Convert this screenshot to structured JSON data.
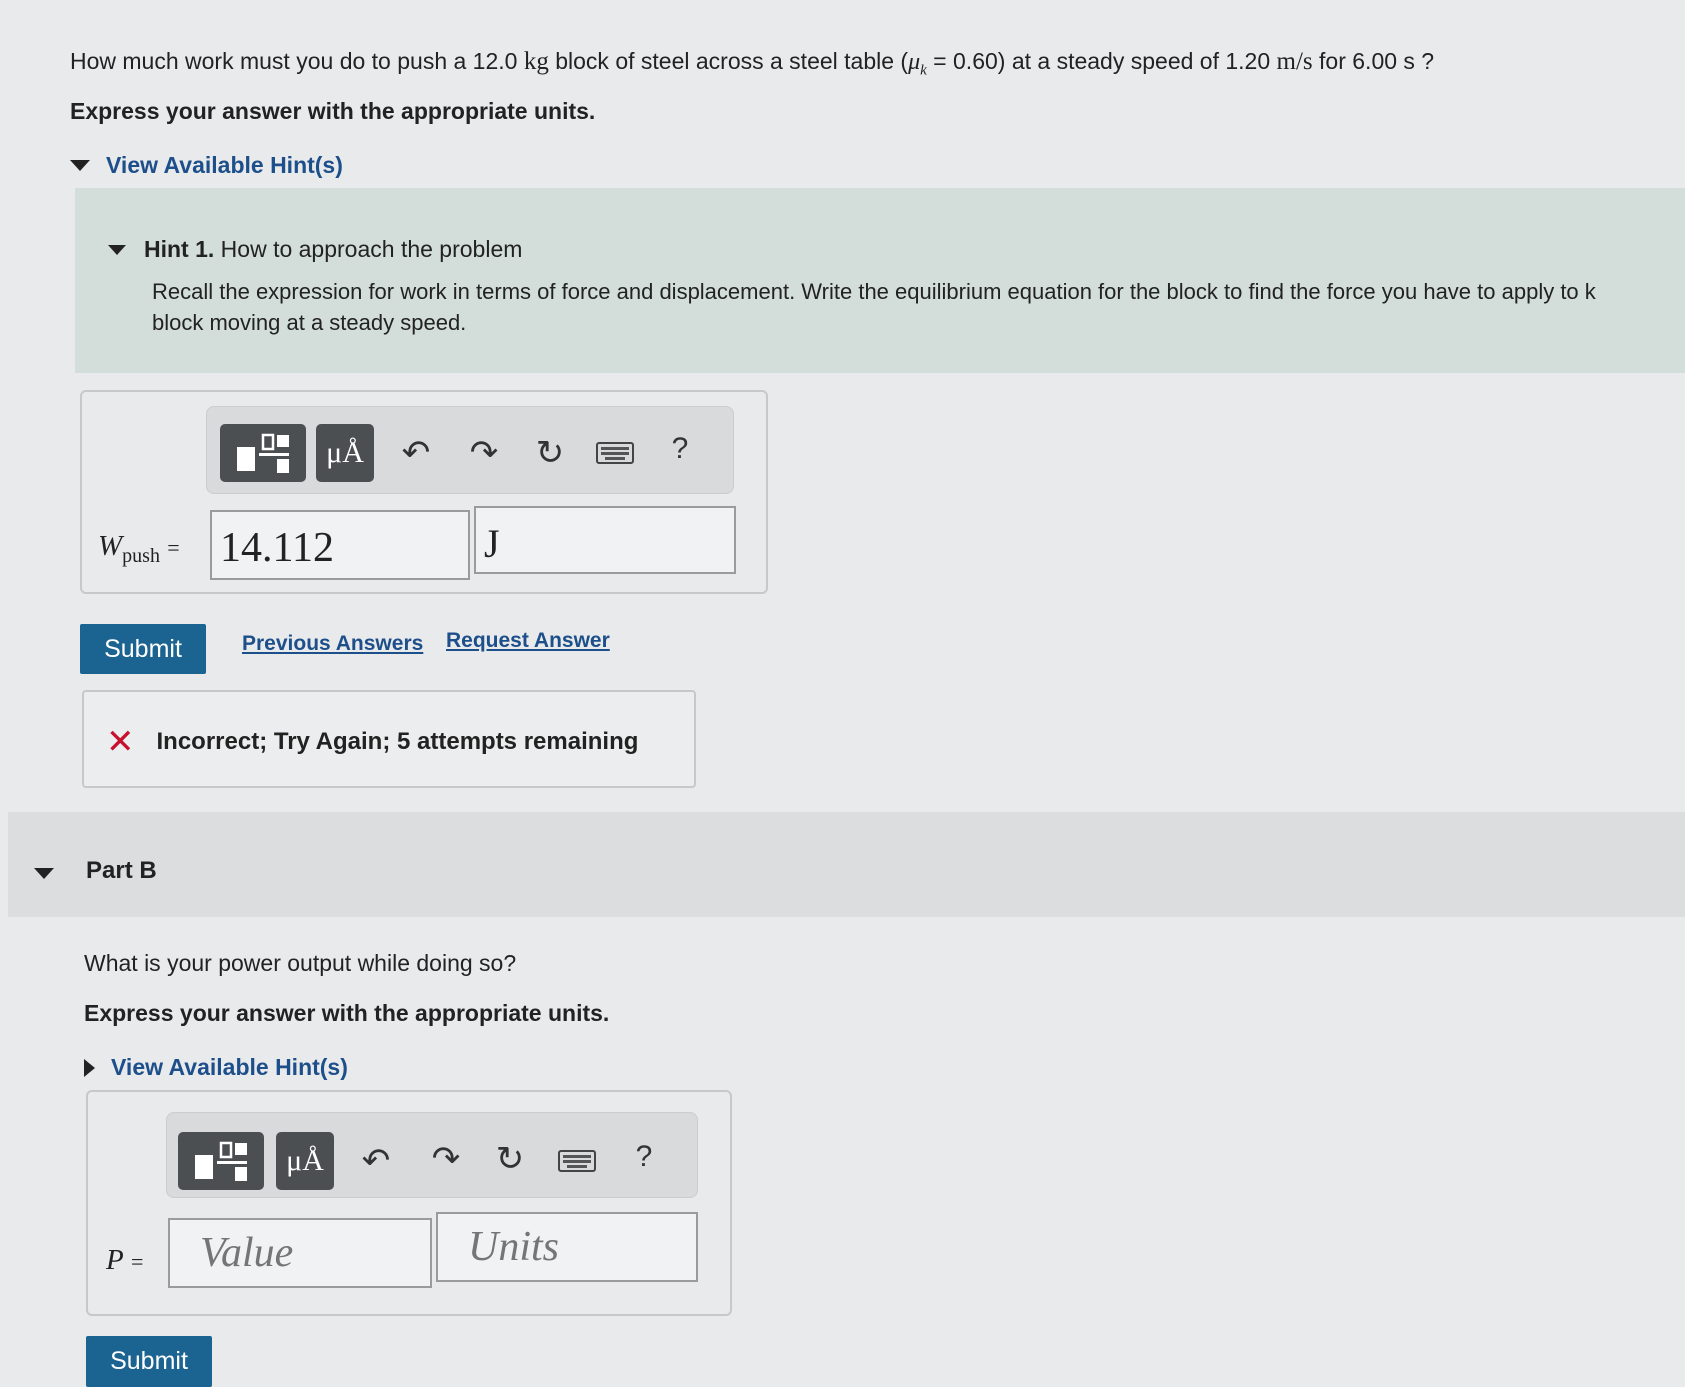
{
  "question": {
    "text_before_mass": "How much work must you do to push a 12.0",
    "mass_unit": "kg",
    "text_mid": "block of steel across a steel table (",
    "mu_symbol": "μ",
    "mu_sub": "k",
    "text_mu_value": " = 0.60) at a steady speed of 1.20",
    "speed_unit": "m/s",
    "text_time": "for 6.00 s ?"
  },
  "part_a": {
    "express_instruction": "Express your answer with the appropriate units.",
    "hints_toggle": "View Available Hint(s)",
    "hint1_title_bold": "Hint 1.",
    "hint1_title": "How to approach the problem",
    "hint1_body_line1": "Recall the expression for work in terms of force and displacement. Write the equilibrium equation for the block to find the force you have to apply to k",
    "hint1_body_line2": "block moving at a steady speed.",
    "toolbar": {
      "template_icon": "templates-icon",
      "symbols_label": "μÅ",
      "help_label": "?"
    },
    "var_main": "W",
    "var_sub": "push",
    "equals": "=",
    "value": "14.112",
    "units": "J",
    "submit_label": "Submit",
    "previous_answers_link": "Previous Answers",
    "request_answer_link": "Request Answer",
    "feedback_icon": "✕",
    "feedback_text": "Incorrect; Try Again; 5 attempts remaining"
  },
  "part_b": {
    "title": "Part B",
    "question": "What is your power output while doing so?",
    "express_instruction": "Express your answer with the appropriate units.",
    "hints_toggle": "View Available Hint(s)",
    "toolbar": {
      "symbols_label": "μÅ",
      "help_label": "?"
    },
    "var": "P",
    "equals": "=",
    "value_placeholder": "Value",
    "units_placeholder": "Units",
    "submit_label": "Submit"
  },
  "colors": {
    "link": "#1d4f8a",
    "submit_bg": "#1b6390",
    "error_x": "#c8102e",
    "hint_bg": "#d3dedb"
  }
}
